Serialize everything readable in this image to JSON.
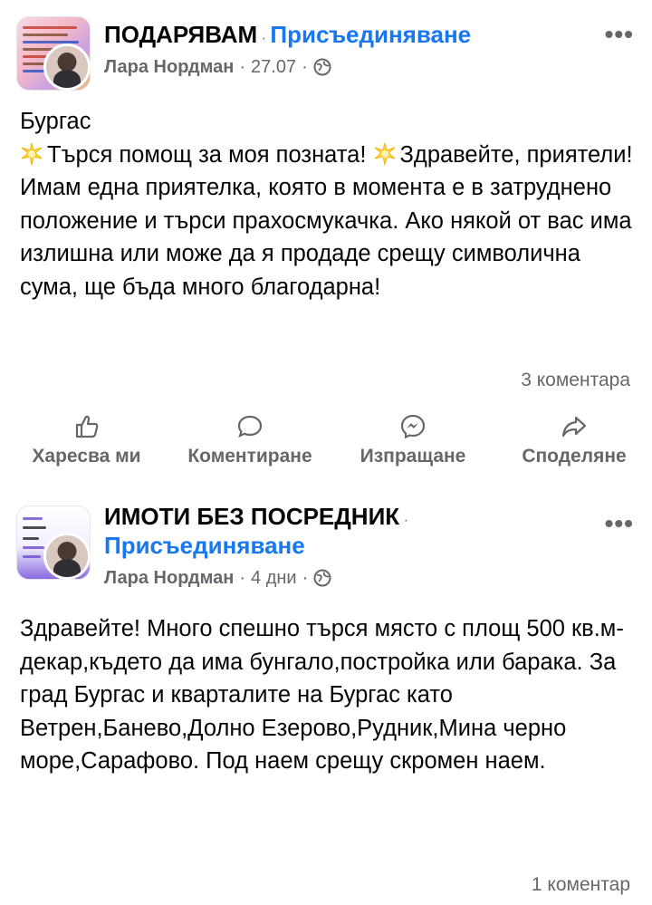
{
  "posts": [
    {
      "group_name": "ПОДАРЯВАМ",
      "join_label": "Присъединяване",
      "author": "Лара Нордман",
      "time": "27.07",
      "text_lines": [
        "Бургас",
        "Търся помощ за моя позната!",
        "Здравейте, приятели!Имам една приятелка, която в момента е в затруднено положение и търси прахосмукачка. Ако някой от вас има излишна или може да я продаде срещу символична сума, ще бъда много благодарна!"
      ],
      "comments": "3 коментара",
      "actions": [
        "Харесва ми",
        "Коментиране",
        "Изпращане",
        "Споделяне"
      ],
      "icons": [
        "like-icon",
        "comment-icon",
        "messenger-icon",
        "share-icon"
      ]
    },
    {
      "group_name": "ИМОТИ БЕЗ ПОСРЕДНИК",
      "join_label": "Присъединяване",
      "author": "Лара Нордман",
      "time": "4 дни",
      "text": "Здравейте! Много спешно търся място с площ 500 кв.м-декар,където да има бунгало,постройка или барака. За град Бургас и кварталите на Бургас като Ветрен,Банево,Долно Езерово,Рудник,Мина черно море,Сарафово. Под наем срещу скромен наем.",
      "comments": "1 коментар"
    }
  ],
  "ui": {
    "separator": "·",
    "more": "•••"
  },
  "colors": {
    "link": "#1877f2",
    "meta": "#65676b",
    "text": "#050505"
  }
}
